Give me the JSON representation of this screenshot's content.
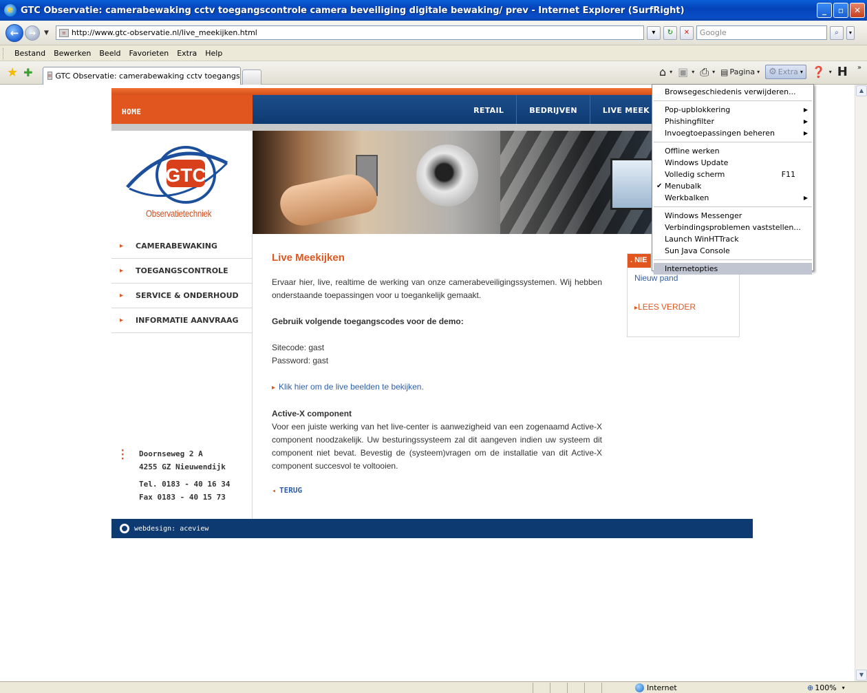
{
  "window": {
    "title": "GTC Observatie: camerabewaking cctv toegangscontrole camera beveiliging digitale bewaking/ prev - Internet Explorer (SurfRight)",
    "buttons": [
      "_",
      "▫",
      "✕"
    ]
  },
  "address_bar": {
    "url": "http://www.gtc-observatie.nl/live_meekijken.html",
    "search_placeholder": "Google"
  },
  "menubar": {
    "items": [
      "Bestand",
      "Bewerken",
      "Beeld",
      "Favorieten",
      "Extra",
      "Help"
    ]
  },
  "tab": {
    "title": "GTC Observatie: camerabewaking cctv toegangscontr..."
  },
  "command_bar": {
    "page_label": "Pagina",
    "extra_label": "Extra"
  },
  "site": {
    "home_label": "HOME",
    "nav": [
      "RETAIL",
      "BEDRIJVEN",
      "LIVE MEEK"
    ],
    "logo_text": "GTC",
    "logo_subtitle": "Observatietechniek",
    "sidebar": [
      "CAMERABEWAKING",
      "TOEGANGSCONTROLE",
      "SERVICE & ONDERHOUD",
      "INFORMATIE AANVRAAG"
    ],
    "address": {
      "street": "Doornseweg 2 A",
      "city": "4255 GZ Nieuwendijk",
      "tel": "Tel. 0183 - 40 16 34",
      "fax": "Fax 0183 - 40 15 73"
    },
    "content": {
      "heading": "Live Meekijken",
      "intro": "Ervaar hier, live, realtime de werking van onze camerabeveiligingssystemen. Wij hebben onderstaande toepassingen voor u toegankelijk gemaakt.",
      "codes_heading": "Gebruik volgende toegangscodes voor de demo:",
      "sitecode": "Sitecode: gast",
      "password": "Password: gast",
      "live_link": "Klik hier om de live beelden te bekijken.",
      "activex_heading": "Active-X component",
      "activex_text": "Voor een juiste werking van het live-center is aanwezigheid van een zogenaamd Active-X component noodzakelijk. Uw besturingssysteem zal dit aangeven indien uw systeem dit component niet bevat. Bevestig de (systeem)vragen om de installatie van dit Active-X component succesvol te voltooien.",
      "back_label": "TERUG"
    },
    "news": {
      "header": ". NIE",
      "item": "Nieuw pand",
      "more": "LEES VERDER"
    },
    "footer": "webdesign: aceview"
  },
  "extra_menu": {
    "group1": [
      {
        "label": "Browsegeschiedenis verwijderen..."
      }
    ],
    "group2": [
      {
        "label": "Pop-upblokkering",
        "submenu": true
      },
      {
        "label": "Phishingfilter",
        "submenu": true
      },
      {
        "label": "Invoegtoepassingen beheren",
        "submenu": true
      }
    ],
    "group3": [
      {
        "label": "Offline werken"
      },
      {
        "label": "Windows Update"
      },
      {
        "label": "Volledig scherm",
        "shortcut": "F11"
      },
      {
        "label": "Menubalk",
        "checked": true
      },
      {
        "label": "Werkbalken",
        "submenu": true
      }
    ],
    "group4": [
      {
        "label": "Windows Messenger"
      },
      {
        "label": "Verbindingsproblemen vaststellen..."
      },
      {
        "label": "Launch WinHTTrack"
      },
      {
        "label": "Sun Java Console"
      }
    ],
    "group5": [
      {
        "label": "Internetopties",
        "highlighted": true
      }
    ]
  },
  "status_bar": {
    "zone": "Internet",
    "zoom": "100%"
  },
  "colors": {
    "accent_orange": "#e0561e",
    "nav_blue": "#0e3a72",
    "link_blue": "#2f5ea8"
  }
}
